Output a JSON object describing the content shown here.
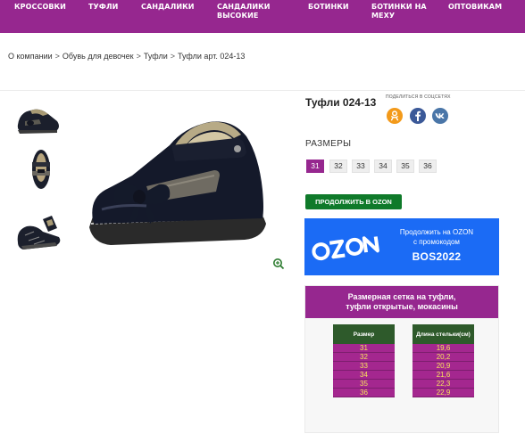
{
  "nav": {
    "items": [
      {
        "label": "КРОССОВКИ"
      },
      {
        "label": "ТУФЛИ"
      },
      {
        "label": "САНДАЛИКИ"
      },
      {
        "label_line1": "САНДАЛИКИ",
        "label_line2": "ВЫСОКИЕ"
      },
      {
        "label": "БОТИНКИ"
      },
      {
        "label_line1": "БОТИНКИ НА",
        "label_line2": "МЕХУ"
      },
      {
        "label": "ОПТОВИКАМ"
      }
    ]
  },
  "breadcrumb": {
    "items": [
      "О компании",
      "Обувь для девочек",
      "Туфли",
      "Туфли арт. 024-13"
    ],
    "separator": ">"
  },
  "product": {
    "title": "Туфли 024-13",
    "share_label": "ПОДЕЛИТЬСЯ В СОЦСЕТЯХ",
    "social_icons": [
      "odnoklassniki-icon",
      "facebook-icon",
      "vk-icon"
    ],
    "sizes_label": "РАЗМЕРЫ",
    "sizes": [
      "31",
      "32",
      "33",
      "34",
      "35",
      "36"
    ],
    "selected_size": "31",
    "ozon_button_label": "ПРОДОЛЖИТЬ В OZON"
  },
  "ozon_banner": {
    "logo": "OZON",
    "line1": "Продолжить на OZON",
    "line2": "с промокодом",
    "promo_code": "BOS2022"
  },
  "size_chart": {
    "title_line1": "Размерная сетка на туфли,",
    "title_line2": "туфли открытые, мокасины",
    "col_size_header": "Размер",
    "col_length_header": "Длина стельки(см)",
    "rows": [
      {
        "size": "31",
        "length": "19,6"
      },
      {
        "size": "32",
        "length": "20,2"
      },
      {
        "size": "33",
        "length": "20,9"
      },
      {
        "size": "34",
        "length": "21,6"
      },
      {
        "size": "35",
        "length": "22,3"
      },
      {
        "size": "36",
        "length": "22,9"
      }
    ]
  },
  "colors": {
    "brand_purple": "#96278f",
    "button_green": "#0f7a2a",
    "ozon_blue": "#1b6bf5",
    "table_header_green": "#2e5a2b",
    "table_cell_text": "#f5e35a"
  }
}
